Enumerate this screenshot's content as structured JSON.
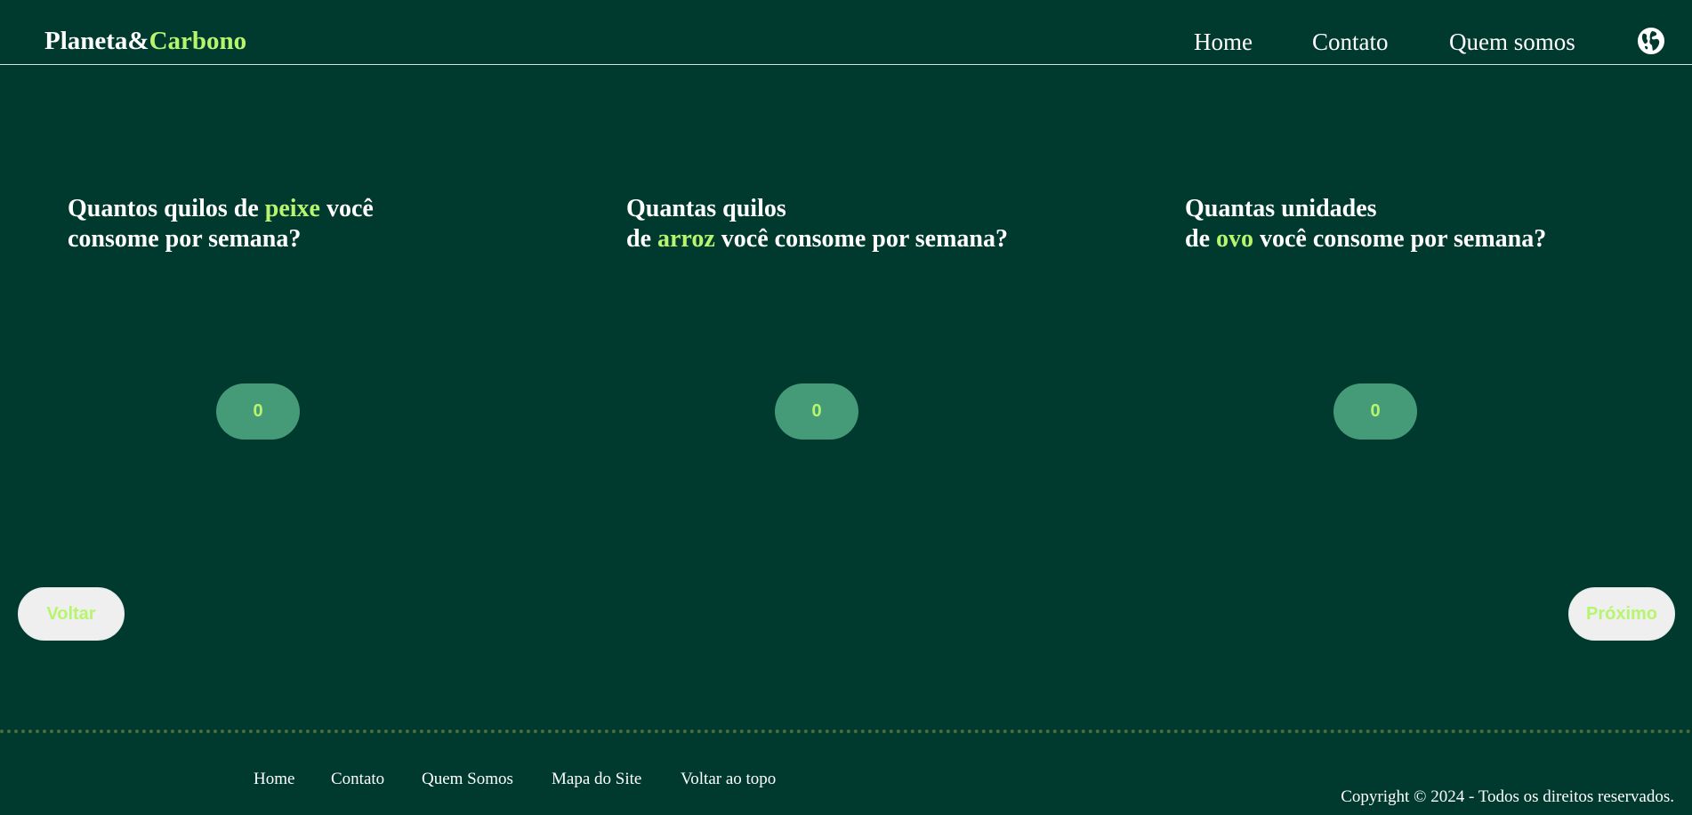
{
  "header": {
    "brand_part1": "Planeta&",
    "brand_part2": "Carbono",
    "nav": [
      "Home",
      "Contato",
      "Quem somos"
    ],
    "globe_icon": "globe-icon"
  },
  "questions": [
    {
      "line1_pre": "Quantos quilos de ",
      "highlight": "peixe",
      "line1_post": " você",
      "line2": "consome por semana?",
      "value": "0"
    },
    {
      "line1": "Quantas quilos",
      "line2_pre": "de ",
      "highlight": "arroz",
      "line2_post": " você consome por semana?",
      "value": "0"
    },
    {
      "line1": "Quantas unidades",
      "line2_pre": "de ",
      "highlight": "ovo",
      "line2_post": " você consome por semana?",
      "value": "0"
    }
  ],
  "buttons": {
    "back": "Voltar",
    "next": "Próximo"
  },
  "footer": {
    "links": [
      "Home",
      "Contato",
      "Quem Somos",
      "Mapa do Site",
      "Voltar ao topo"
    ],
    "copyright": "Copyright © 2024 - Todos os direitos reservados."
  },
  "colors": {
    "background": "#003a2f",
    "accent": "#b7f56f",
    "pill": "#459a77"
  }
}
